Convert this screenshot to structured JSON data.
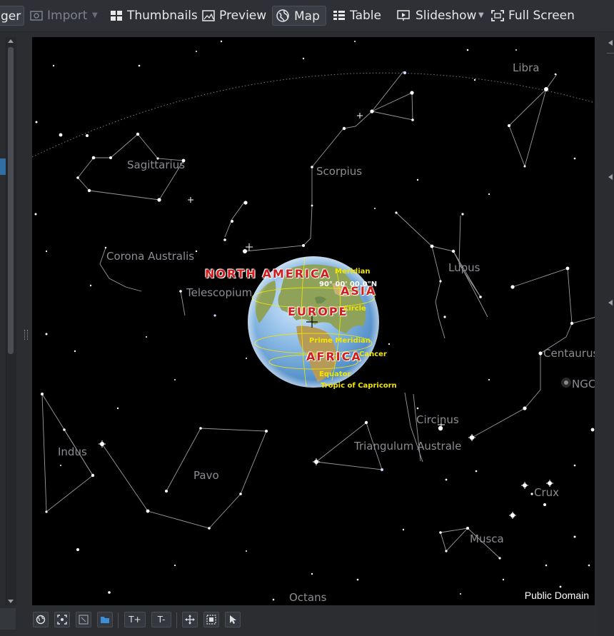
{
  "toolbar": {
    "manager_label": "ger",
    "import_label": "Import",
    "thumbnails_label": "Thumbnails",
    "preview_label": "Preview",
    "map_label": "Map",
    "table_label": "Table",
    "slideshow_label": "Slideshow",
    "fullscreen_label": "Full Screen",
    "active_view": "Map"
  },
  "map": {
    "constellations": [
      "Libra",
      "Sagittarius",
      "Scorpius",
      "Corona Australis",
      "Telescopium",
      "Lupus",
      "Centaurus",
      "NGC",
      "Circinus",
      "Triangulum Australe",
      "Indus",
      "Pavo",
      "Crux",
      "Musca",
      "Octans"
    ],
    "continents": [
      "NORTH AMERICA",
      "ASIA",
      "EUROPE",
      "AFRICA"
    ],
    "globe_labels": [
      "Meridian",
      "90° 00' 00.0\"N",
      "Circle",
      "Prime Meridian",
      "Cancer",
      "Equator",
      "Tropic of Capricorn"
    ],
    "attribution": "Public Domain",
    "colors": {
      "sky": "#000000",
      "constellation_lines": "#9a9ca0",
      "globe_label": "#f2e600",
      "continent_label": "#d11d1d"
    }
  },
  "bottom": {
    "zoom_in_label": "T+",
    "zoom_out_label": "T-",
    "icons": [
      "globe-settings-icon",
      "fit-to-selection-icon",
      "zoom-region-icon",
      "folder-icon",
      "move-icon",
      "select-region-icon",
      "pointer-icon"
    ]
  }
}
